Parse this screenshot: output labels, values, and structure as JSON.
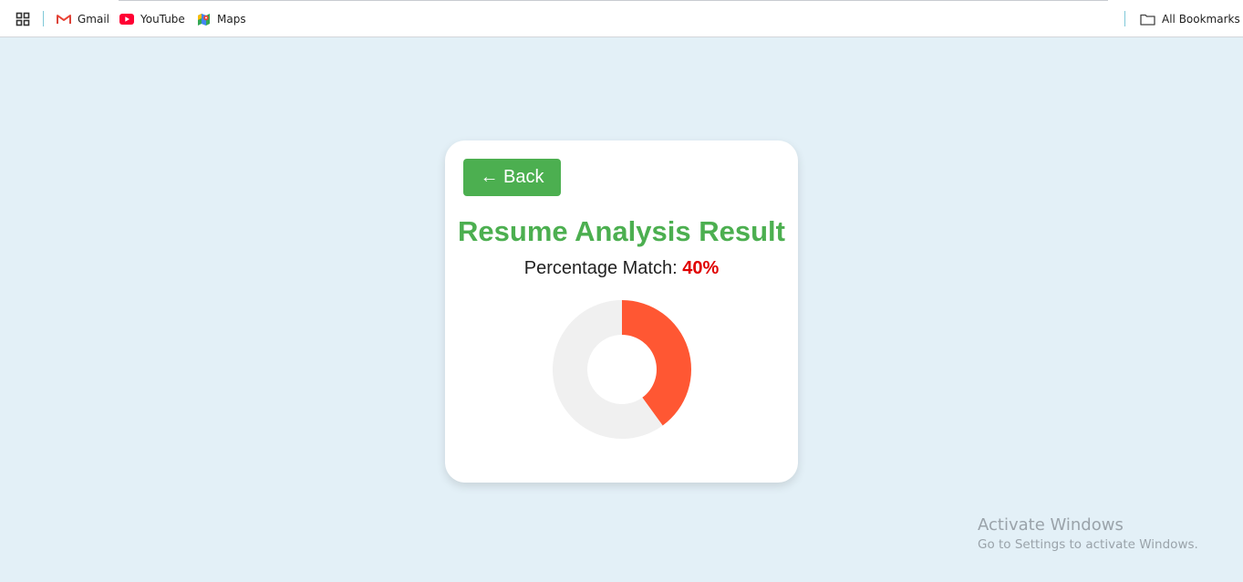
{
  "bookmarks_bar": {
    "items": [
      {
        "label": "Gmail",
        "icon": "gmail-icon"
      },
      {
        "label": "YouTube",
        "icon": "youtube-icon"
      },
      {
        "label": "Maps",
        "icon": "maps-icon"
      }
    ],
    "all_bookmarks_label": "All Bookmarks"
  },
  "card": {
    "back_label": "← Back",
    "title": "Resume Analysis Result",
    "match_label": "Percentage Match:",
    "match_value": "40%"
  },
  "chart_data": {
    "type": "pie",
    "variant": "doughnut",
    "values": [
      40,
      60
    ],
    "colors": [
      "#ff5733",
      "#f0f0f0"
    ]
  },
  "watermark": {
    "title": "Activate Windows",
    "subtitle": "Go to Settings to activate Windows."
  },
  "colors": {
    "accent_green": "#4caf50",
    "match_red": "#e00000",
    "page_background": "#e3f0f7"
  }
}
